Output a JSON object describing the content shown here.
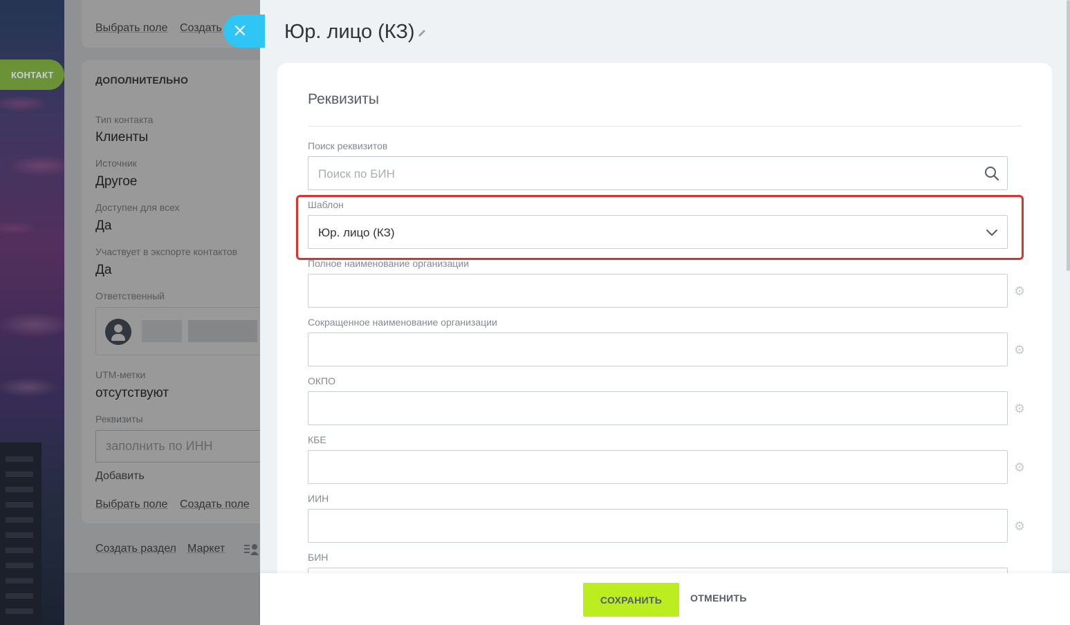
{
  "sidebar": {
    "contact_tab": "КОНТАКТ"
  },
  "left_page": {
    "top_links": {
      "choose_field": "Выбрать поле",
      "create": "Создать"
    },
    "section_header": "ДОПОЛНИТЕЛЬНО",
    "fields": [
      {
        "label": "Тип контакта",
        "value": "Клиенты"
      },
      {
        "label": "Источник",
        "value": "Другое"
      },
      {
        "label": "Доступен для всех",
        "value": "Да"
      },
      {
        "label": "Участвует в экспорте контактов",
        "value": "Да"
      }
    ],
    "responsible_label": "Ответственный",
    "utm": {
      "label": "UTM-метки",
      "value": "отсутствуют"
    },
    "requisites": {
      "label": "Реквизиты",
      "placeholder": "заполнить по ИНН",
      "add": "Добавить"
    },
    "bottom_links": {
      "choose_field": "Выбрать поле",
      "create_field": "Создать поле"
    },
    "footer_links": {
      "create_section": "Создать раздел",
      "market": "Маркет"
    }
  },
  "slider": {
    "title": "Юр. лицо (КЗ)",
    "section_title": "Реквизиты",
    "search": {
      "label": "Поиск реквизитов",
      "placeholder": "Поиск по БИН"
    },
    "template": {
      "label": "Шаблон",
      "value": "Юр. лицо (КЗ)"
    },
    "fields": [
      {
        "label": "Полное наименование организации"
      },
      {
        "label": "Сокращенное наименование организации"
      },
      {
        "label": "ОКПО"
      },
      {
        "label": "КБЕ"
      },
      {
        "label": "ИИН"
      },
      {
        "label": "БИН"
      }
    ]
  },
  "buttons": {
    "save": "СОХРАНИТЬ",
    "cancel": "ОТМЕНИТЬ"
  },
  "colors": {
    "accent_save": "#bbed21",
    "close": "#2fc6f6",
    "highlight": "#d9332e",
    "contact_tab": "#7db12a"
  }
}
